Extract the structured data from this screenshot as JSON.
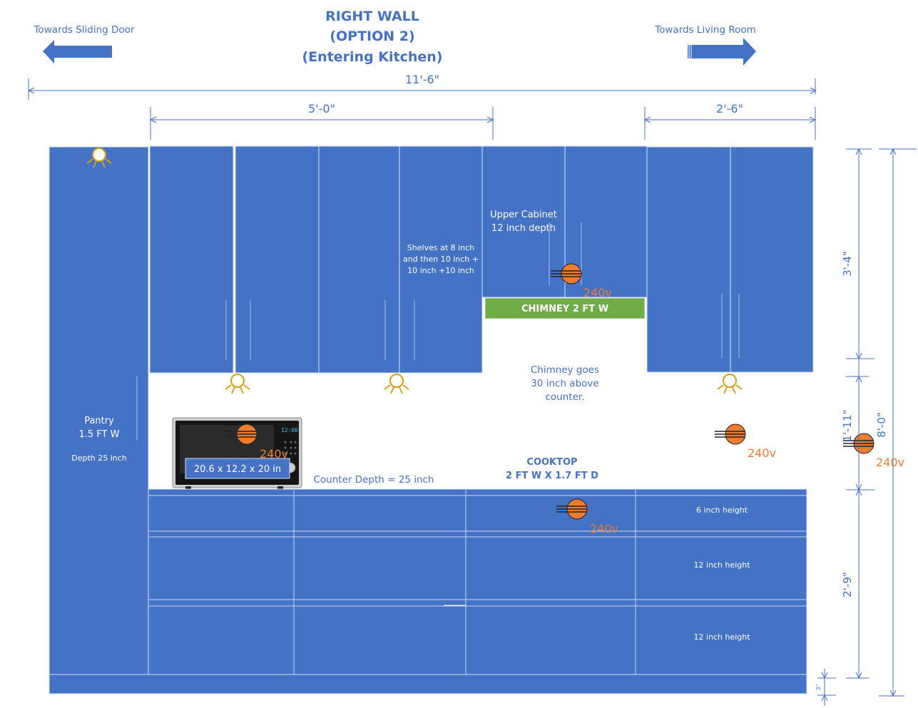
{
  "title": {
    "line1": "RIGHT WALL",
    "line2": "(OPTION 2)",
    "line3": "(Entering Kitchen)"
  },
  "directions": {
    "left": "Towards Sliding Door",
    "right": "Towards Living Room"
  },
  "dimensions": {
    "overall_width": "11'-6\"",
    "upper_left_width": "5'-0\"",
    "upper_right_width": "2'-6\"",
    "upper_height": "3'-4\"",
    "gap_height": "1'-11\"",
    "base_height": "2'-9\"",
    "toe_kick": "3\"",
    "total_height": "8'-0\""
  },
  "labels": {
    "pantry_name": "Pantry",
    "pantry_width": "1.5 FT W",
    "pantry_depth": "Depth 25 inch",
    "upper_cabinet_line1": "Upper Cabinet",
    "upper_cabinet_line2": "12 inch depth",
    "shelves_line1": "Shelves at 8 inch",
    "shelves_line2": "and then 10 inch +",
    "shelves_line3": "10 inch +10 inch",
    "chimney": "CHIMNEY 2 FT W",
    "chimney_note_line1": "Chimney goes",
    "chimney_note_line2": "30 inch above",
    "chimney_note_line3": "counter.",
    "microwave_size": "20.6 x 12.2 x 20 in",
    "microwave_display": "12:00",
    "counter_depth": "Counter Depth = 25 inch",
    "cooktop_line1": "COOKTOP",
    "cooktop_line2": "2 FT W X 1.7 FT D",
    "drawer1": "6 inch height",
    "drawer2": "12 inch height",
    "drawer3": "12 inch height"
  },
  "outlets": {
    "voltage": "240v"
  },
  "colors": {
    "cabinet": "#4472c4",
    "chimney": "#70ad47",
    "outlet": "#ed7d31",
    "light": "#d4a017"
  }
}
